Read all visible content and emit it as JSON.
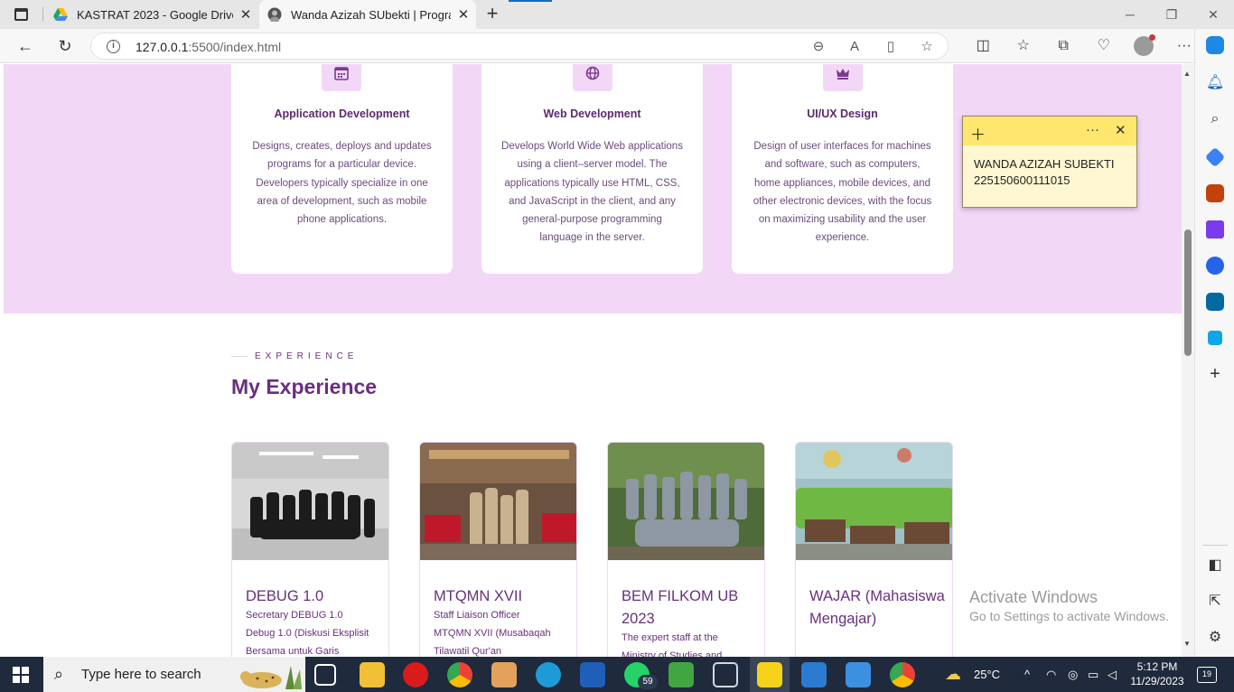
{
  "browser": {
    "tabs": [
      {
        "title": "KASTRAT 2023 - Google Drive",
        "active": false
      },
      {
        "title": "Wanda Azizah SUbekti | Program",
        "active": true
      }
    ],
    "url_host": "127.0.0.1",
    "url_path": ":5500/index.html"
  },
  "services": [
    {
      "icon": "calendar-icon",
      "title": "Application Development",
      "description": "Designs, creates, deploys and updates programs for a particular device. Developers typically specialize in one area of development, such as mobile phone applications."
    },
    {
      "icon": "globe-icon",
      "title": "Web Development",
      "description": "Develops World Wide Web applications using a client–server model. The applications typically use HTML, CSS, and JavaScript in the client, and any general-purpose programming language in the server."
    },
    {
      "icon": "crown-icon",
      "title": "UI/UX Design",
      "description": "Design of user interfaces for machines and software, such as computers, home appliances, mobile devices, and other electronic devices, with the focus on maximizing usability and the user experience."
    }
  ],
  "experience": {
    "eyebrow": "EXPERIENCE",
    "title": "My Experience",
    "items": [
      {
        "name": "DEBUG 1.0",
        "lines": [
          "Secretary DEBUG 1.0",
          "Debug 1.0 (Diskusi Eksplisit",
          "Bersama untuk Garis"
        ]
      },
      {
        "name": "MTQMN XVII",
        "lines": [
          "Staff Liaison Officer",
          "MTQMN XVII (Musabaqah",
          "Tilawatil Qur'an"
        ]
      },
      {
        "name": "BEM FILKOM UB 2023",
        "lines": [
          "The expert staff at the",
          "Ministry of Studies and"
        ]
      },
      {
        "name": "WAJAR (Mahasiswa Mengajar)",
        "lines": []
      }
    ]
  },
  "sticky_note": {
    "line1": "WANDA AZIZAH SUBEKTI",
    "line2": "225150600111015"
  },
  "watermark": {
    "line1": "Activate Windows",
    "line2": "Go to Settings to activate Windows."
  },
  "taskbar": {
    "search_placeholder": "Type here to search",
    "whatsapp_badge": "59",
    "temperature": "25°C",
    "time": "5:12 PM",
    "date": "11/29/2023",
    "notifications": "19"
  }
}
